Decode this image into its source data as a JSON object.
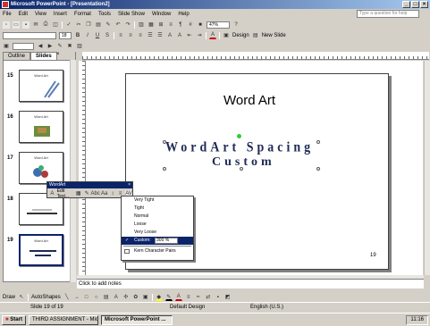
{
  "window": {
    "title": "Microsoft PowerPoint - [Presentation2]"
  },
  "menu": {
    "items": [
      "File",
      "Edit",
      "View",
      "Insert",
      "Format",
      "Tools",
      "Slide Show",
      "Window",
      "Help"
    ],
    "ask_placeholder": "Type a question for help"
  },
  "toolbar": {
    "zoom": "47%",
    "font_size": "18",
    "design_label": "Design",
    "new_slide_label": "New Slide"
  },
  "tabs": {
    "outline": "Outline",
    "slides": "Slides"
  },
  "thumbnails": [
    {
      "num": "15",
      "caption": "Word Art"
    },
    {
      "num": "16",
      "caption": "Word Art"
    },
    {
      "num": "17",
      "caption": "Word Art"
    },
    {
      "num": "18",
      "caption": ""
    },
    {
      "num": "19",
      "caption": "Word Art"
    }
  ],
  "wordart_toolbar": {
    "title": "WordArt",
    "edit_text": "Edit Text..."
  },
  "slide": {
    "title": "Word Art",
    "wordart_line1": "WordArt Spacing",
    "wordart_line2": "Custom",
    "page_number": "19"
  },
  "spacing_menu": {
    "items": [
      "Very Tight",
      "Tight",
      "Normal",
      "Loose",
      "Very Loose"
    ],
    "custom_label": "Custom:",
    "custom_value": "300 %",
    "kern_label": "Kern Character Pairs"
  },
  "notes": {
    "placeholder": "Click to add notes"
  },
  "drawing": {
    "draw_label": "Draw",
    "autoshapes_label": "AutoShapes"
  },
  "status": {
    "slide": "Slide 19 of 19",
    "design": "Default Design",
    "lang": "English (U.S.)"
  },
  "taskbar": {
    "start": "Start",
    "tasks": [
      "THIRD ASSIGNMENT - Micro...",
      "Microsoft PowerPoint ..."
    ],
    "clock": "11:16"
  }
}
